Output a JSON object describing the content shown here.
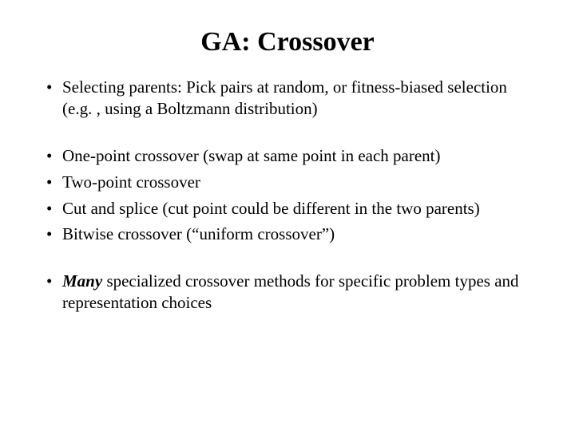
{
  "title": "GA: Crossover",
  "group1": {
    "b1": "Selecting parents: Pick pairs at random, or fitness-biased selection (e.g. , using a Boltzmann distribution)"
  },
  "group2": {
    "b1": "One-point crossover (swap at same point in each parent)",
    "b2": "Two-point crossover",
    "b3": "Cut and splice (cut point could be different in the two parents)",
    "b4": "Bitwise crossover (“uniform crossover”)"
  },
  "group3": {
    "b1_emph": "Many",
    "b1_rest": " specialized crossover methods for specific problem types and representation choices"
  }
}
